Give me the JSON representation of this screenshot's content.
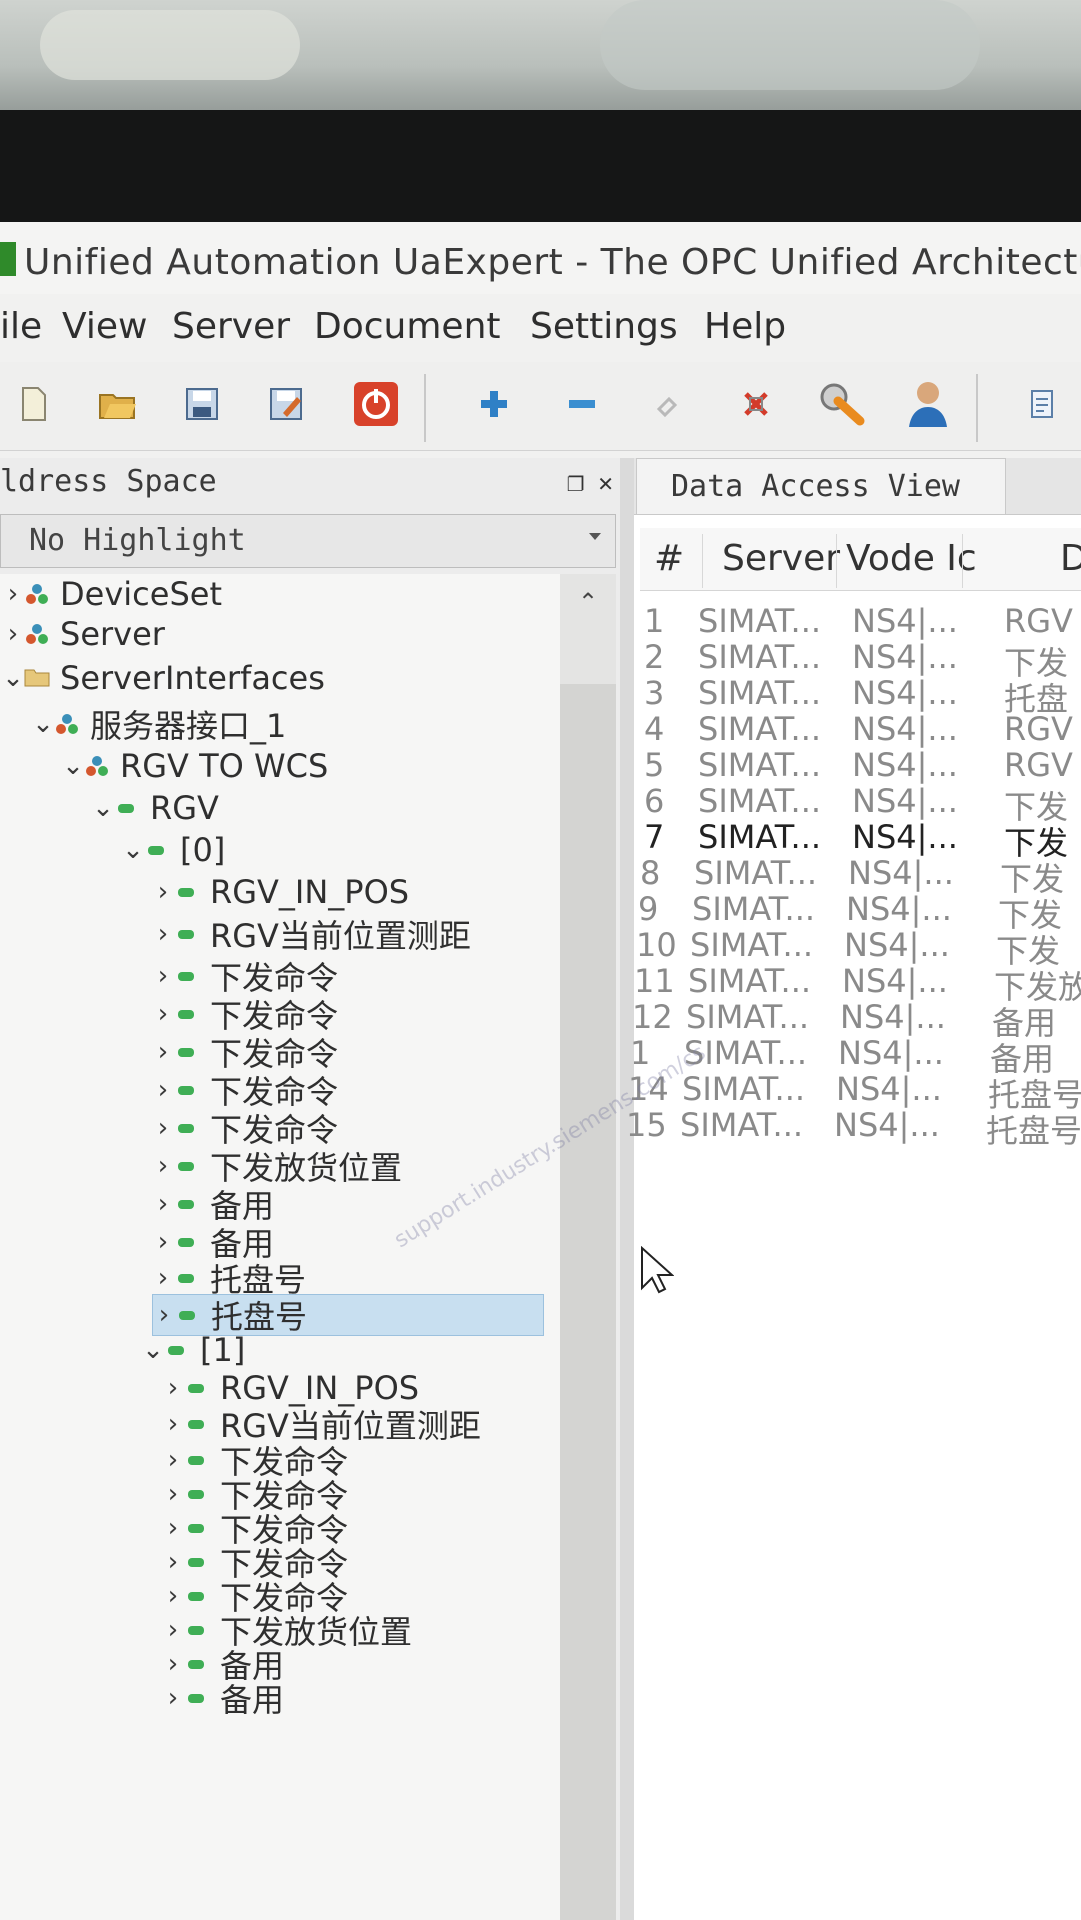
{
  "window": {
    "title": "Unified Automation UaExpert - The OPC Unified Architectu"
  },
  "menu": [
    "ile",
    "View",
    "Server",
    "Document",
    "Settings",
    "Help"
  ],
  "toolbar": {
    "icons": [
      "new-document-icon",
      "open-folder-icon",
      "save-icon",
      "save-as-icon",
      "disconnect-icon",
      "add-server-icon",
      "remove-server-icon",
      "connect-icon",
      "disconnect-server-icon",
      "settings-icon",
      "user-icon",
      "report-icon"
    ]
  },
  "address_space": {
    "title": "ldress Space",
    "highlight_value": "No Highlight",
    "tree": [
      {
        "label": "DeviceSet",
        "chevron": ">"
      },
      {
        "label": "Server",
        "chevron": ">"
      },
      {
        "label": "ServerInterfaces",
        "chevron": "v"
      },
      {
        "label": "服务器接口_1",
        "chevron": "v"
      },
      {
        "label": "RGV TO WCS",
        "chevron": "v"
      },
      {
        "label": "RGV",
        "chevron": "v"
      },
      {
        "label": "[0]",
        "chevron": "v"
      },
      {
        "label": "RGV_IN_POS",
        "chevron": ">"
      },
      {
        "label": "RGV当前位置测距",
        "chevron": ">"
      },
      {
        "label": "下发命令",
        "chevron": ">"
      },
      {
        "label": "下发命令",
        "chevron": ">"
      },
      {
        "label": "下发命令",
        "chevron": ">"
      },
      {
        "label": "下发命令",
        "chevron": ">"
      },
      {
        "label": "下发命令",
        "chevron": ">"
      },
      {
        "label": "下发放货位置",
        "chevron": ">"
      },
      {
        "label": "备用",
        "chevron": ">"
      },
      {
        "label": "备用",
        "chevron": ">"
      },
      {
        "label": "托盘号",
        "chevron": ">"
      },
      {
        "label": "托盘号",
        "chevron": ">",
        "selected": true
      },
      {
        "label": "[1]",
        "chevron": "v"
      },
      {
        "label": "RGV_IN_POS",
        "chevron": ">"
      },
      {
        "label": "RGV当前位置测距",
        "chevron": ">"
      },
      {
        "label": "下发命令",
        "chevron": ">"
      },
      {
        "label": "下发命令",
        "chevron": ">"
      },
      {
        "label": "下发命令",
        "chevron": ">"
      },
      {
        "label": "下发命令",
        "chevron": ">"
      },
      {
        "label": "下发命令",
        "chevron": ">"
      },
      {
        "label": "下发放货位置",
        "chevron": ">"
      },
      {
        "label": "备用",
        "chevron": ">"
      },
      {
        "label": "备用",
        "chevron": ">"
      }
    ]
  },
  "data_access_view": {
    "tab_label": "Data Access View",
    "columns": [
      "#",
      "Server",
      "Vode Ic",
      "D"
    ],
    "rows": [
      {
        "n": "1",
        "server": "SIMAT...",
        "node": "NS4|...",
        "display": "RGV"
      },
      {
        "n": "2",
        "server": "SIMAT...",
        "node": "NS4|...",
        "display": "下发"
      },
      {
        "n": "3",
        "server": "SIMAT...",
        "node": "NS4|...",
        "display": "托盘"
      },
      {
        "n": "4",
        "server": "SIMAT...",
        "node": "NS4|...",
        "display": "RGV"
      },
      {
        "n": "5",
        "server": "SIMAT...",
        "node": "NS4|...",
        "display": "RGV"
      },
      {
        "n": "6",
        "server": "SIMAT...",
        "node": "NS4|...",
        "display": "下发"
      },
      {
        "n": "7",
        "server": "SIMAT...",
        "node": "NS4|...",
        "display": "下发",
        "bold": true
      },
      {
        "n": "8",
        "server": "SIMAT...",
        "node": "NS4|...",
        "display": "下发"
      },
      {
        "n": "9",
        "server": "SIMAT...",
        "node": "NS4|...",
        "display": "下发"
      },
      {
        "n": "10",
        "server": "SIMAT...",
        "node": "NS4|...",
        "display": "下发"
      },
      {
        "n": "11",
        "server": "SIMAT...",
        "node": "NS4|...",
        "display": "下发放"
      },
      {
        "n": "12",
        "server": "SIMAT...",
        "node": "NS4|...",
        "display": "备用"
      },
      {
        "n": "1",
        "server": "SIMAT...",
        "node": "NS4|...",
        "display": "备用"
      },
      {
        "n": "14",
        "server": "SIMAT...",
        "node": "NS4|...",
        "display": "托盘号"
      },
      {
        "n": "15",
        "server": "SIMAT...",
        "node": "NS4|...",
        "display": "托盘号"
      }
    ]
  },
  "watermark": "support.industry.siemens.com/cs",
  "colors": {
    "accent_green": "#2f8a2a",
    "selection": "#c8dff0",
    "variable_node": "#3fae55",
    "object_node": "#3a8fb8"
  }
}
